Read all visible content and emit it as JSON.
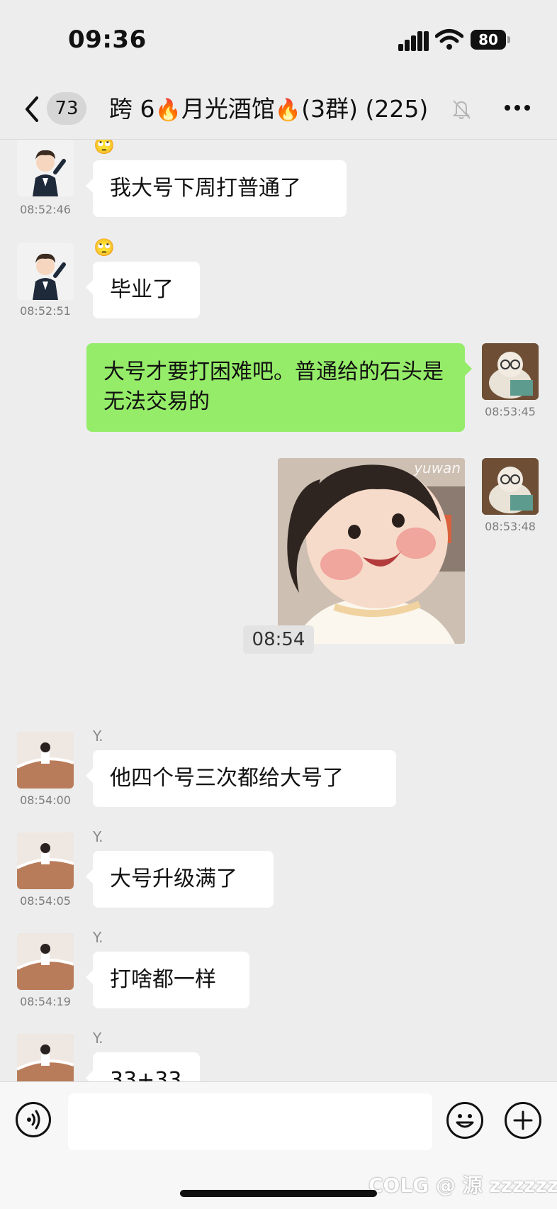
{
  "status_bar": {
    "time": "09:36",
    "battery": "80"
  },
  "header": {
    "unread_count": "73",
    "title_part1": "跨 6",
    "title_part2": "月光酒馆",
    "title_part3": "(3群) (225)",
    "flame_glyph": "🔥"
  },
  "messages": [
    {
      "side": "left",
      "emoji": "🙄",
      "text": "我大号下周打普通了",
      "time": "08:52:46"
    },
    {
      "side": "left",
      "emoji": "🙄",
      "text": "毕业了",
      "time": "08:52:51"
    },
    {
      "side": "right",
      "text": "大号才要打困难吧。普通给的石头是无法交易的",
      "time": "08:53:45"
    },
    {
      "side": "right",
      "type": "image",
      "watermark": "yuwan",
      "time": "08:53:48"
    }
  ],
  "time_separator": "08:54",
  "messages_after": [
    {
      "side": "left",
      "sender": "Y.",
      "text": "他四个号三次都给大号了",
      "time": "08:54:00"
    },
    {
      "side": "left",
      "sender": "Y.",
      "text": "大号升级满了",
      "time": "08:54:05"
    },
    {
      "side": "left",
      "sender": "Y.",
      "text": "打啥都一样",
      "time": "08:54:19"
    },
    {
      "side": "left",
      "sender": "Y.",
      "text": "33+33"
    }
  ],
  "input": {
    "value": "",
    "placeholder": ""
  },
  "watermark": "COLG @ 源 zzzzzzz",
  "icons": [
    "back-chevron-icon",
    "mute-bell-icon",
    "more-icon",
    "voice-icon",
    "emoji-icon",
    "plus-icon"
  ],
  "colors": {
    "background": "#ededed",
    "sent_bubble": "#95ec69",
    "received_bubble": "#ffffff"
  }
}
